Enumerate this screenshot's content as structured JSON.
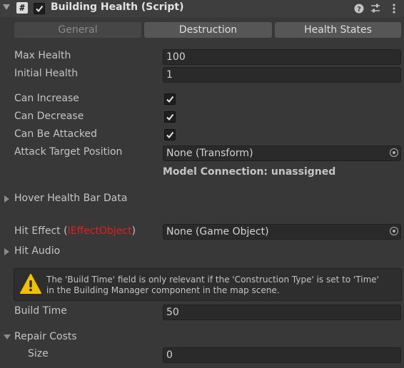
{
  "header": {
    "script_icon_glyph": "#",
    "enabled": true,
    "title": "Building Health (Script)",
    "help_icon": "help-icon",
    "presets_icon": "presets-icon",
    "more_icon": "more-icon"
  },
  "tabs": [
    {
      "label": "General",
      "active": true
    },
    {
      "label": "Destruction",
      "active": false
    },
    {
      "label": "Health States",
      "active": false
    }
  ],
  "fields": {
    "max_health": {
      "label": "Max Health",
      "value": "100"
    },
    "initial_health": {
      "label": "Initial Health",
      "value": "1"
    },
    "can_increase": {
      "label": "Can Increase",
      "checked": true
    },
    "can_decrease": {
      "label": "Can Decrease",
      "checked": true
    },
    "can_be_attacked": {
      "label": "Can Be Attacked",
      "checked": true
    },
    "attack_target_position": {
      "label": "Attack Target Position",
      "value": "None (Transform)"
    },
    "model_connection": "Model Connection: unassigned",
    "hover_health_bar_data": {
      "label": "Hover Health Bar Data"
    },
    "hit_effect": {
      "label_prefix": "Hit Effect (",
      "label_type": "IEffectObject",
      "label_suffix": ")",
      "value": "None (Game Object)"
    },
    "hit_audio": {
      "label": "Hit Audio"
    },
    "help_message_line1": "The 'Build Time' field is only relevant if the 'Construction Type' is set to 'Time'",
    "help_message_line2": "in the Building Manager component in the map scene.",
    "build_time": {
      "label": "Build Time",
      "value": "50"
    },
    "repair_costs": {
      "label": "Repair Costs"
    },
    "size": {
      "label": "Size",
      "value": "0"
    }
  },
  "colors": {
    "background": "#383838",
    "error_red": "#e02020",
    "warning_yellow": "#f2c200"
  }
}
